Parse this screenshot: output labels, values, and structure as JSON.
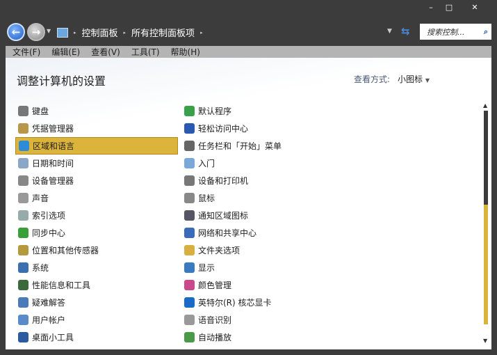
{
  "window": {
    "minimize": "–",
    "maximize": "□",
    "close": "✕"
  },
  "breadcrumb": [
    "控制面板",
    "所有控制面板项"
  ],
  "search": {
    "placeholder": "搜索控制..."
  },
  "menu": [
    "文件(F)",
    "编辑(E)",
    "查看(V)",
    "工具(T)",
    "帮助(H)"
  ],
  "page_title": "调整计算机的设置",
  "view_by": {
    "label": "查看方式:",
    "value": "小图标"
  },
  "left_items": [
    {
      "label": "键盘",
      "color": "#777"
    },
    {
      "label": "凭据管理器",
      "color": "#b8964a"
    },
    {
      "label": "区域和语言",
      "color": "#2e8bd6"
    },
    {
      "label": "日期和时间",
      "color": "#8aa7c8"
    },
    {
      "label": "设备管理器",
      "color": "#888"
    },
    {
      "label": "声音",
      "color": "#999"
    },
    {
      "label": "索引选项",
      "color": "#9aa"
    },
    {
      "label": "同步中心",
      "color": "#3a9e3a"
    },
    {
      "label": "位置和其他传感器",
      "color": "#b49a3c"
    },
    {
      "label": "系统",
      "color": "#3a6fb0"
    },
    {
      "label": "性能信息和工具",
      "color": "#3c6a3c"
    },
    {
      "label": "疑难解答",
      "color": "#4a7ab8"
    },
    {
      "label": "用户帐户",
      "color": "#5a8ac8"
    },
    {
      "label": "桌面小工具",
      "color": "#2a5aa0"
    }
  ],
  "right_items": [
    {
      "label": "默认程序",
      "color": "#3aa04a"
    },
    {
      "label": "轻松访问中心",
      "color": "#2a5ab0"
    },
    {
      "label": "任务栏和「开始」菜单",
      "color": "#666"
    },
    {
      "label": "入门",
      "color": "#7aa8d8"
    },
    {
      "label": "设备和打印机",
      "color": "#777"
    },
    {
      "label": "鼠标",
      "color": "#888"
    },
    {
      "label": "通知区域图标",
      "color": "#556"
    },
    {
      "label": "网络和共享中心",
      "color": "#3a6ab8"
    },
    {
      "label": "文件夹选项",
      "color": "#d8b040"
    },
    {
      "label": "显示",
      "color": "#3a7ac0"
    },
    {
      "label": "颜色管理",
      "color": "#c84a8a"
    },
    {
      "label": "英特尔(R) 核芯显卡",
      "color": "#1a6ac8"
    },
    {
      "label": "语音识别",
      "color": "#999"
    },
    {
      "label": "自动播放",
      "color": "#4a9a4a"
    }
  ],
  "selected_index": 2
}
